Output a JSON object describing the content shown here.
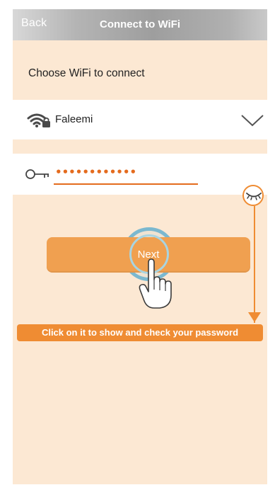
{
  "header": {
    "back_label": "Back",
    "title": "Connect to WiFi"
  },
  "main": {
    "section_label": "Choose WiFi to connect",
    "wifi_network": {
      "name": "Faleemi",
      "icon": "wifi-locked-icon"
    },
    "password": {
      "value": "••••••••••••",
      "icon": "key-icon",
      "toggle_icon": "eye-closed-icon"
    },
    "next_label": "Next"
  },
  "overlay": {
    "hint": "Click on it to show and check your password",
    "pointer_icon": "hand-pointer-icon"
  },
  "colors": {
    "accent": "#ef8c33",
    "background": "#fce8d3",
    "button": "#f0a050",
    "ripple": "#7bb8cf"
  }
}
